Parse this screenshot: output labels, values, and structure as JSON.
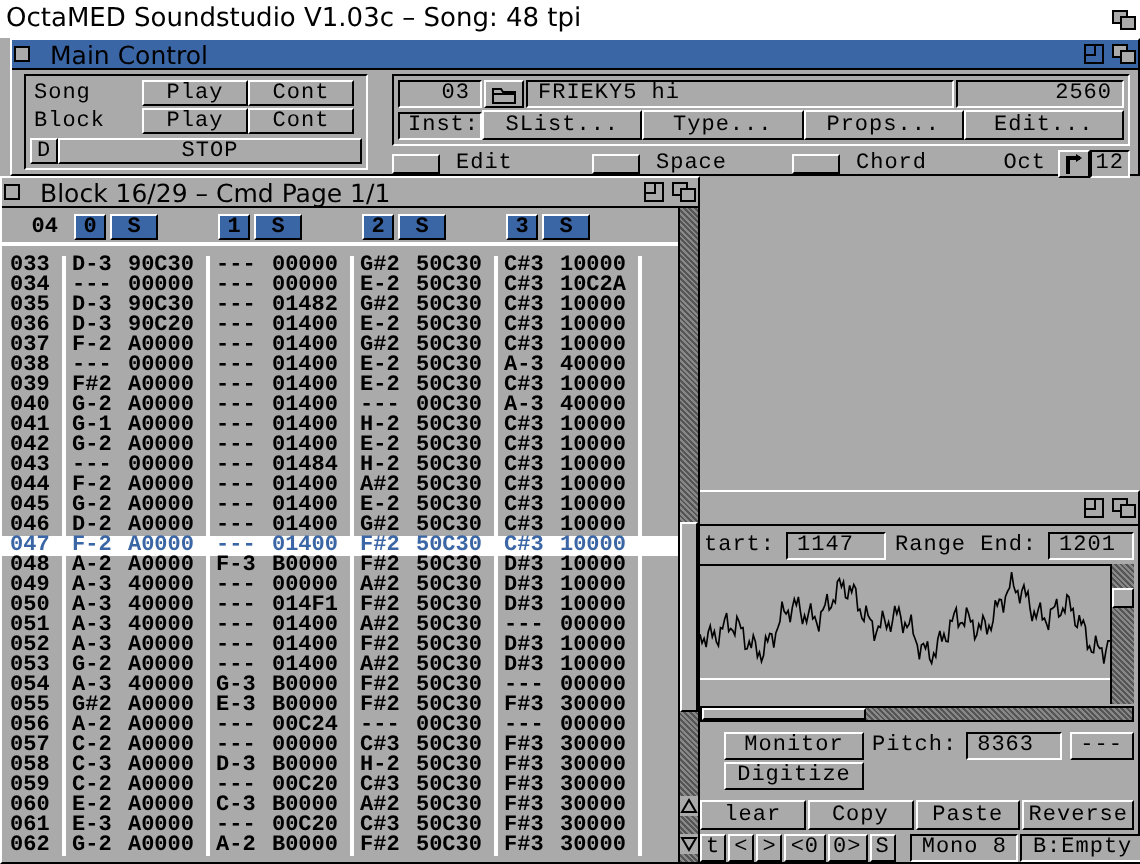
{
  "screen_title": "OctaMED Soundstudio V1.03c – Song: 48 tpi",
  "main_control": {
    "title": "Main Control",
    "transport": [
      {
        "label": "Song",
        "play": "Play",
        "cont": "Cont"
      },
      {
        "label": "Block",
        "play": "Play",
        "cont": "Cont"
      }
    ],
    "d_button": "D",
    "stop_button": "STOP",
    "instrument": {
      "number": "03",
      "name": "FRIEKY5 hi",
      "length": "2560",
      "inst_label": "Inst:",
      "buttons": [
        {
          "label": "SList..."
        },
        {
          "label": "Type..."
        },
        {
          "label": "Props..."
        },
        {
          "label": "Edit..."
        }
      ]
    },
    "toggles": [
      {
        "label": "Edit",
        "on": false
      },
      {
        "label": "Space",
        "on": false
      },
      {
        "label": "Chord",
        "on": false
      }
    ],
    "oct_label": "Oct",
    "oct_value": "12"
  },
  "tracker": {
    "title": "Block 16/29 – Cmd Page 1/1",
    "line_count": "04",
    "tracks": [
      {
        "number": "0",
        "label": "S"
      },
      {
        "number": "1",
        "label": "S"
      },
      {
        "number": "2",
        "label": "S"
      },
      {
        "number": "3",
        "label": "S"
      }
    ],
    "rows": [
      {
        "line": "033",
        "cells": [
          [
            "D-3",
            "90C30"
          ],
          [
            "---",
            "00000"
          ],
          [
            "G#2",
            "50C30"
          ],
          [
            "C#3",
            "10000"
          ]
        ],
        "selected": false
      },
      {
        "line": "034",
        "cells": [
          [
            "---",
            "00000"
          ],
          [
            "---",
            "00000"
          ],
          [
            "E-2",
            "50C30"
          ],
          [
            "C#3",
            "10C2A"
          ]
        ],
        "selected": false
      },
      {
        "line": "035",
        "cells": [
          [
            "D-3",
            "90C30"
          ],
          [
            "---",
            "01482"
          ],
          [
            "G#2",
            "50C30"
          ],
          [
            "C#3",
            "10000"
          ]
        ],
        "selected": false
      },
      {
        "line": "036",
        "cells": [
          [
            "D-3",
            "90C20"
          ],
          [
            "---",
            "01400"
          ],
          [
            "E-2",
            "50C30"
          ],
          [
            "C#3",
            "10000"
          ]
        ],
        "selected": false
      },
      {
        "line": "037",
        "cells": [
          [
            "F-2",
            "A0000"
          ],
          [
            "---",
            "01400"
          ],
          [
            "G#2",
            "50C30"
          ],
          [
            "C#3",
            "10000"
          ]
        ],
        "selected": false
      },
      {
        "line": "038",
        "cells": [
          [
            "---",
            "00000"
          ],
          [
            "---",
            "01400"
          ],
          [
            "E-2",
            "50C30"
          ],
          [
            "A-3",
            "40000"
          ]
        ],
        "selected": false
      },
      {
        "line": "039",
        "cells": [
          [
            "F#2",
            "A0000"
          ],
          [
            "---",
            "01400"
          ],
          [
            "E-2",
            "50C30"
          ],
          [
            "C#3",
            "10000"
          ]
        ],
        "selected": false
      },
      {
        "line": "040",
        "cells": [
          [
            "G-2",
            "A0000"
          ],
          [
            "---",
            "01400"
          ],
          [
            "---",
            "00C30"
          ],
          [
            "A-3",
            "40000"
          ]
        ],
        "selected": false
      },
      {
        "line": "041",
        "cells": [
          [
            "G-1",
            "A0000"
          ],
          [
            "---",
            "01400"
          ],
          [
            "H-2",
            "50C30"
          ],
          [
            "C#3",
            "10000"
          ]
        ],
        "selected": false
      },
      {
        "line": "042",
        "cells": [
          [
            "G-2",
            "A0000"
          ],
          [
            "---",
            "01400"
          ],
          [
            "E-2",
            "50C30"
          ],
          [
            "C#3",
            "10000"
          ]
        ],
        "selected": false
      },
      {
        "line": "043",
        "cells": [
          [
            "---",
            "00000"
          ],
          [
            "---",
            "01484"
          ],
          [
            "H-2",
            "50C30"
          ],
          [
            "C#3",
            "10000"
          ]
        ],
        "selected": false
      },
      {
        "line": "044",
        "cells": [
          [
            "F-2",
            "A0000"
          ],
          [
            "---",
            "01400"
          ],
          [
            "A#2",
            "50C30"
          ],
          [
            "C#3",
            "10000"
          ]
        ],
        "selected": false
      },
      {
        "line": "045",
        "cells": [
          [
            "G-2",
            "A0000"
          ],
          [
            "---",
            "01400"
          ],
          [
            "E-2",
            "50C30"
          ],
          [
            "C#3",
            "10000"
          ]
        ],
        "selected": false
      },
      {
        "line": "046",
        "cells": [
          [
            "D-2",
            "A0000"
          ],
          [
            "---",
            "01400"
          ],
          [
            "G#2",
            "50C30"
          ],
          [
            "C#3",
            "10000"
          ]
        ],
        "selected": false
      },
      {
        "line": "047",
        "cells": [
          [
            "F-2",
            "A0000"
          ],
          [
            "---",
            "01400"
          ],
          [
            "F#2",
            "50C30"
          ],
          [
            "C#3",
            "10000"
          ]
        ],
        "selected": true
      },
      {
        "line": "048",
        "cells": [
          [
            "A-2",
            "A0000"
          ],
          [
            "F-3",
            "B0000"
          ],
          [
            "F#2",
            "50C30"
          ],
          [
            "D#3",
            "10000"
          ]
        ],
        "selected": false
      },
      {
        "line": "049",
        "cells": [
          [
            "A-3",
            "40000"
          ],
          [
            "---",
            "00000"
          ],
          [
            "A#2",
            "50C30"
          ],
          [
            "D#3",
            "10000"
          ]
        ],
        "selected": false
      },
      {
        "line": "050",
        "cells": [
          [
            "A-3",
            "40000"
          ],
          [
            "---",
            "014F1"
          ],
          [
            "F#2",
            "50C30"
          ],
          [
            "D#3",
            "10000"
          ]
        ],
        "selected": false
      },
      {
        "line": "051",
        "cells": [
          [
            "A-3",
            "40000"
          ],
          [
            "---",
            "01400"
          ],
          [
            "A#2",
            "50C30"
          ],
          [
            "---",
            "00000"
          ]
        ],
        "selected": false
      },
      {
        "line": "052",
        "cells": [
          [
            "A-3",
            "A0000"
          ],
          [
            "---",
            "01400"
          ],
          [
            "F#2",
            "50C30"
          ],
          [
            "D#3",
            "10000"
          ]
        ],
        "selected": false
      },
      {
        "line": "053",
        "cells": [
          [
            "G-2",
            "A0000"
          ],
          [
            "---",
            "01400"
          ],
          [
            "A#2",
            "50C30"
          ],
          [
            "D#3",
            "10000"
          ]
        ],
        "selected": false
      },
      {
        "line": "054",
        "cells": [
          [
            "A-3",
            "40000"
          ],
          [
            "G-3",
            "B0000"
          ],
          [
            "F#2",
            "50C30"
          ],
          [
            "---",
            "00000"
          ]
        ],
        "selected": false
      },
      {
        "line": "055",
        "cells": [
          [
            "G#2",
            "A0000"
          ],
          [
            "E-3",
            "B0000"
          ],
          [
            "F#2",
            "50C30"
          ],
          [
            "F#3",
            "30000"
          ]
        ],
        "selected": false
      },
      {
        "line": "056",
        "cells": [
          [
            "A-2",
            "A0000"
          ],
          [
            "---",
            "00C24"
          ],
          [
            "---",
            "00C30"
          ],
          [
            "---",
            "00000"
          ]
        ],
        "selected": false
      },
      {
        "line": "057",
        "cells": [
          [
            "C-2",
            "A0000"
          ],
          [
            "---",
            "00000"
          ],
          [
            "C#3",
            "50C30"
          ],
          [
            "F#3",
            "30000"
          ]
        ],
        "selected": false
      },
      {
        "line": "058",
        "cells": [
          [
            "C-3",
            "A0000"
          ],
          [
            "D-3",
            "B0000"
          ],
          [
            "H-2",
            "50C30"
          ],
          [
            "F#3",
            "30000"
          ]
        ],
        "selected": false
      },
      {
        "line": "059",
        "cells": [
          [
            "C-2",
            "A0000"
          ],
          [
            "---",
            "00C20"
          ],
          [
            "C#3",
            "50C30"
          ],
          [
            "F#3",
            "30000"
          ]
        ],
        "selected": false
      },
      {
        "line": "060",
        "cells": [
          [
            "E-2",
            "A0000"
          ],
          [
            "C-3",
            "B0000"
          ],
          [
            "A#2",
            "50C30"
          ],
          [
            "F#3",
            "30000"
          ]
        ],
        "selected": false
      },
      {
        "line": "061",
        "cells": [
          [
            "E-3",
            "A0000"
          ],
          [
            "---",
            "00C20"
          ],
          [
            "C#3",
            "50C30"
          ],
          [
            "F#3",
            "30000"
          ]
        ],
        "selected": false
      },
      {
        "line": "062",
        "cells": [
          [
            "G-2",
            "A0000"
          ],
          [
            "A-2",
            "B0000"
          ],
          [
            "F#2",
            "50C30"
          ],
          [
            "F#3",
            "30000"
          ]
        ],
        "selected": false
      }
    ]
  },
  "sample_editor": {
    "range_start_label": "tart:",
    "range_start": "1147",
    "range_end_label": "Range End:",
    "range_end": "1201",
    "monitor": "Monitor",
    "digitize": "Digitize",
    "pitch_label": "Pitch:",
    "pitch": "8363",
    "pitch_button": "---",
    "edit_buttons": [
      {
        "label": "lear"
      },
      {
        "label": "Copy"
      },
      {
        "label": "Paste"
      },
      {
        "label": "Reverse"
      }
    ],
    "bottom_buttons": [
      "t",
      "<",
      ">",
      "<0",
      "0>",
      "S"
    ],
    "mode": "Mono 8",
    "buffer": "B:Empty"
  }
}
